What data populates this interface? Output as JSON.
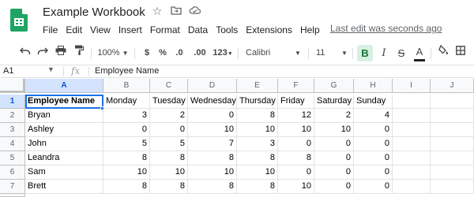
{
  "app": {
    "doc_title": "Example Workbook",
    "last_edit": "Last edit was seconds ago",
    "brand_color": "#1fa463"
  },
  "title_icons": [
    "star-icon",
    "move-to-folder-icon",
    "cloud-saved-icon"
  ],
  "menu": [
    "File",
    "Edit",
    "View",
    "Insert",
    "Format",
    "Data",
    "Tools",
    "Extensions",
    "Help"
  ],
  "toolbar": {
    "zoom": "100%",
    "currency": "$",
    "percent": "%",
    "decrease_decimal": ".0",
    "increase_decimal": ".00",
    "more_formats": "123",
    "font_family": "Calibri",
    "font_size": "11",
    "bold": "B",
    "italic": "I",
    "strikethrough": "S",
    "text_color": "A"
  },
  "formula_bar": {
    "cell_ref": "A1",
    "fx": "fx",
    "value": "Employee Name"
  },
  "grid": {
    "columns": [
      "A",
      "B",
      "C",
      "D",
      "E",
      "F",
      "G",
      "H",
      "I",
      "J"
    ],
    "row_numbers": [
      "1",
      "2",
      "3",
      "4",
      "5",
      "6",
      "7",
      "8"
    ],
    "header": [
      "Employee Name",
      "Monday",
      "Tuesday",
      "Wednesday",
      "Thursday",
      "Friday",
      "Saturday",
      "Sunday"
    ],
    "rows": [
      [
        "Bryan",
        "3",
        "2",
        "0",
        "8",
        "12",
        "2",
        "4"
      ],
      [
        "Ashley",
        "0",
        "0",
        "10",
        "10",
        "10",
        "10",
        "0"
      ],
      [
        "John",
        "5",
        "5",
        "7",
        "3",
        "0",
        "0",
        "0"
      ],
      [
        "Leandra",
        "8",
        "8",
        "8",
        "8",
        "8",
        "0",
        "0"
      ],
      [
        "Sam",
        "10",
        "10",
        "10",
        "10",
        "0",
        "0",
        "0"
      ],
      [
        "Brett",
        "8",
        "8",
        "8",
        "8",
        "10",
        "0",
        "0"
      ]
    ],
    "selected_cell": "A1"
  }
}
